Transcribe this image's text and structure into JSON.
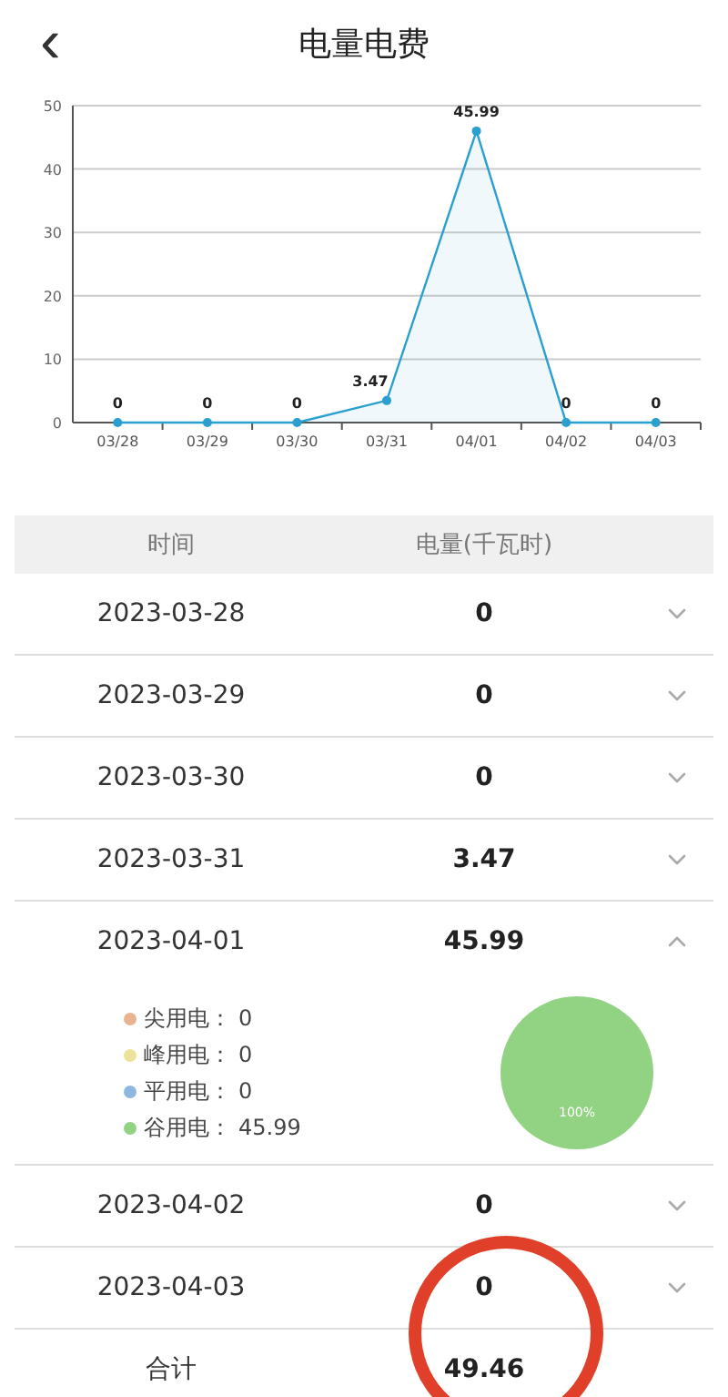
{
  "header": {
    "back_icon": "‹",
    "title": "电量电费"
  },
  "chart": {
    "chart_data": {
      "type": "line",
      "categories": [
        "03/28",
        "03/29",
        "03/30",
        "03/31",
        "04/01",
        "04/02",
        "04/03"
      ],
      "series": [
        {
          "color": "#2a9fd0",
          "marker": true,
          "values": [
            0,
            0,
            0,
            3.47,
            45.99,
            0,
            0
          ]
        }
      ],
      "ylim": [
        0,
        50
      ],
      "yticks": [
        0,
        10,
        20,
        30,
        40,
        50
      ],
      "grid": true,
      "data_labels": true
    }
  },
  "table": {
    "columns": [
      "时间",
      "电量(千瓦时)"
    ],
    "rows": [
      {
        "date": "2023-03-28",
        "value": "0",
        "expanded": false
      },
      {
        "date": "2023-03-29",
        "value": "0",
        "expanded": false
      },
      {
        "date": "2023-03-30",
        "value": "0",
        "expanded": false
      },
      {
        "date": "2023-03-31",
        "value": "3.47",
        "expanded": false
      },
      {
        "date": "2023-04-01",
        "value": "45.99",
        "expanded": true,
        "detail": {
          "legend": [
            {
              "label": "尖用电：",
              "value": "0",
              "color": "#e8b48e"
            },
            {
              "label": "峰用电：",
              "value": "0",
              "color": "#ece29a"
            },
            {
              "label": "平用电：",
              "value": "0",
              "color": "#8fb8e0"
            },
            {
              "label": "谷用电：",
              "value": "45.99",
              "color": "#92d383"
            }
          ],
          "percent_label": "100%",
          "chart_data": {
            "type": "pie",
            "series": [
              {
                "values": [
                  0,
                  0,
                  0,
                  100
                ]
              }
            ]
          }
        }
      },
      {
        "date": "2023-04-02",
        "value": "0",
        "expanded": false
      },
      {
        "date": "2023-04-03",
        "value": "0",
        "expanded": false
      }
    ],
    "total": {
      "label": "合计",
      "value": "49.46"
    }
  }
}
